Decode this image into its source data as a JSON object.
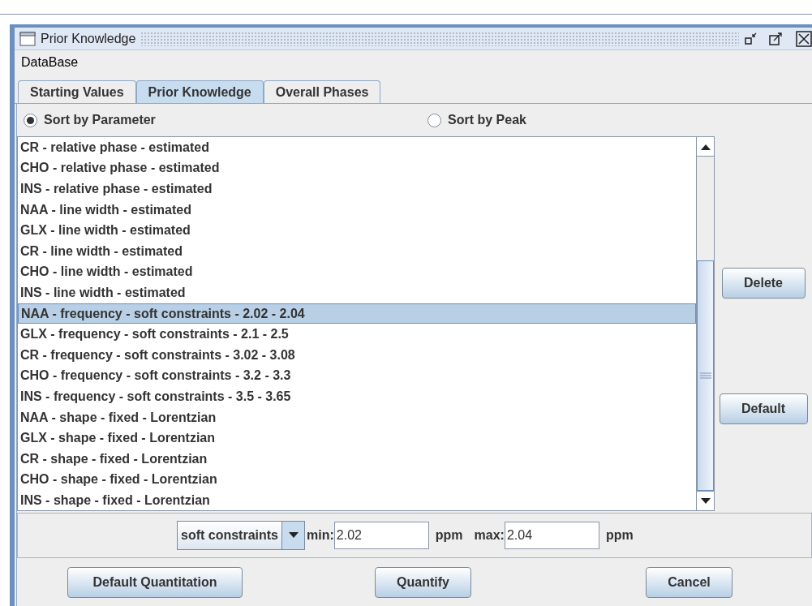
{
  "window": {
    "title": "Prior Knowledge"
  },
  "menu": [
    "DataBase"
  ],
  "tabs": [
    {
      "label": "Starting Values",
      "selected": false
    },
    {
      "label": "Prior Knowledge",
      "selected": true
    },
    {
      "label": "Overall Phases",
      "selected": false
    }
  ],
  "sort_options": [
    {
      "label": "Sort by Parameter",
      "selected": true
    },
    {
      "label": "Sort by Peak",
      "selected": false
    }
  ],
  "list": [
    {
      "text": "CR - relative phase - estimated",
      "selected": false
    },
    {
      "text": "CHO - relative phase - estimated",
      "selected": false
    },
    {
      "text": "INS - relative phase - estimated",
      "selected": false
    },
    {
      "text": "NAA - line width - estimated",
      "selected": false
    },
    {
      "text": "GLX - line width - estimated",
      "selected": false
    },
    {
      "text": "CR - line width - estimated",
      "selected": false
    },
    {
      "text": "CHO - line width - estimated",
      "selected": false
    },
    {
      "text": "INS - line width - estimated",
      "selected": false
    },
    {
      "text": "NAA - frequency - soft constraints - 2.02 - 2.04",
      "selected": true
    },
    {
      "text": "GLX - frequency - soft constraints - 2.1 - 2.5",
      "selected": false
    },
    {
      "text": "CR - frequency - soft constraints - 3.02 - 3.08",
      "selected": false
    },
    {
      "text": "CHO - frequency - soft constraints - 3.2 - 3.3",
      "selected": false
    },
    {
      "text": "INS - frequency - soft constraints - 3.5 - 3.65",
      "selected": false
    },
    {
      "text": "NAA - shape - fixed - Lorentzian",
      "selected": false
    },
    {
      "text": "GLX - shape - fixed - Lorentzian",
      "selected": false
    },
    {
      "text": "CR - shape - fixed - Lorentzian",
      "selected": false
    },
    {
      "text": "CHO - shape - fixed - Lorentzian",
      "selected": false
    },
    {
      "text": "INS - shape - fixed - Lorentzian",
      "selected": false
    }
  ],
  "side_buttons": [
    "Delete",
    "Default"
  ],
  "editor": {
    "constraint": "soft constraints",
    "min_label": "min:",
    "min": "2.02",
    "min_unit": "ppm",
    "max_label": "max:",
    "max": "2.04",
    "max_unit": "ppm"
  },
  "buttons": [
    "Default Quantitation",
    "Quantify",
    "Cancel"
  ]
}
